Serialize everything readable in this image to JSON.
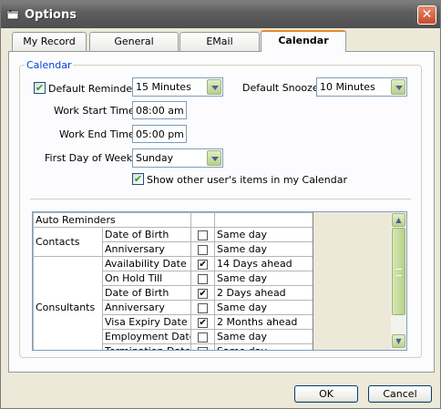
{
  "window": {
    "title": "Options",
    "close_symbol": "✕"
  },
  "tabs": [
    {
      "label": "My Record"
    },
    {
      "label": "General"
    },
    {
      "label": "EMail"
    },
    {
      "label": "Calendar"
    }
  ],
  "calendar": {
    "group_label": "Calendar",
    "default_reminder_label": "Default Reminder:",
    "default_reminder_checked": true,
    "default_reminder_value": "15 Minutes",
    "default_snooze_label": "Default Snooze:",
    "default_snooze_value": "10 Minutes",
    "work_start_label": "Work Start Time:",
    "work_start_value": "08:00 am",
    "work_end_label": "Work End Time:",
    "work_end_value": "05:00 pm",
    "first_day_label": "First Day of Week:",
    "first_day_value": "Sunday",
    "show_other_label": "Show other user's items in my Calendar",
    "show_other_checked": true
  },
  "auto_reminders": {
    "header": "Auto Reminders",
    "groups": [
      {
        "category": "Contacts",
        "rows": [
          {
            "field": "Date of Birth",
            "checked": false,
            "when": "Same day"
          },
          {
            "field": "Anniversary",
            "checked": false,
            "when": "Same day"
          }
        ]
      },
      {
        "category": "Consultants",
        "rows": [
          {
            "field": "Availability Date",
            "checked": true,
            "when": "14 Days ahead"
          },
          {
            "field": "On Hold Till",
            "checked": false,
            "when": "Same day"
          },
          {
            "field": "Date of Birth",
            "checked": true,
            "when": "2 Days ahead"
          },
          {
            "field": "Anniversary",
            "checked": false,
            "when": "Same day"
          },
          {
            "field": "Visa Expiry Date",
            "checked": true,
            "when": "2 Months ahead"
          },
          {
            "field": "Employment Date",
            "checked": false,
            "when": "Same day"
          },
          {
            "field": "Termination Date",
            "checked": false,
            "when": "Same day"
          }
        ]
      }
    ]
  },
  "buttons": {
    "ok": "OK",
    "cancel": "Cancel"
  }
}
